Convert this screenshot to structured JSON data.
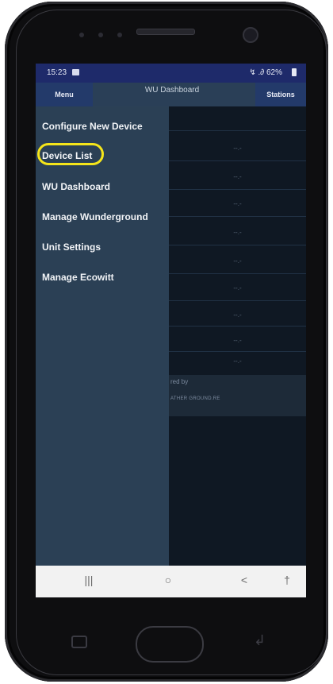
{
  "status_bar": {
    "time": "15:23",
    "signal": "↯ .∂ 62%"
  },
  "header": {
    "menu_label": "Menu",
    "title": "WU Dashboard",
    "stations_label": "Stations"
  },
  "drawer": {
    "items": [
      {
        "label": "Configure New Device"
      },
      {
        "label": "Device List"
      },
      {
        "label": "WU Dashboard"
      },
      {
        "label": "Manage Wunderground"
      },
      {
        "label": "Unit Settings"
      },
      {
        "label": "Manage Ecowitt"
      }
    ],
    "highlighted_item": "Device List"
  },
  "content": {
    "placeholder": "--.-",
    "powered_by": "red by",
    "powered_sub": "ATHER GROUND.RE"
  },
  "nav_bar": {
    "recents": "|||",
    "home": "○",
    "back": "<",
    "accessibility": "†"
  },
  "colors": {
    "highlight": "#f5e51a",
    "drawer": "#2b4055",
    "status_bar": "#1e2a6a",
    "button": "#233a6a"
  }
}
